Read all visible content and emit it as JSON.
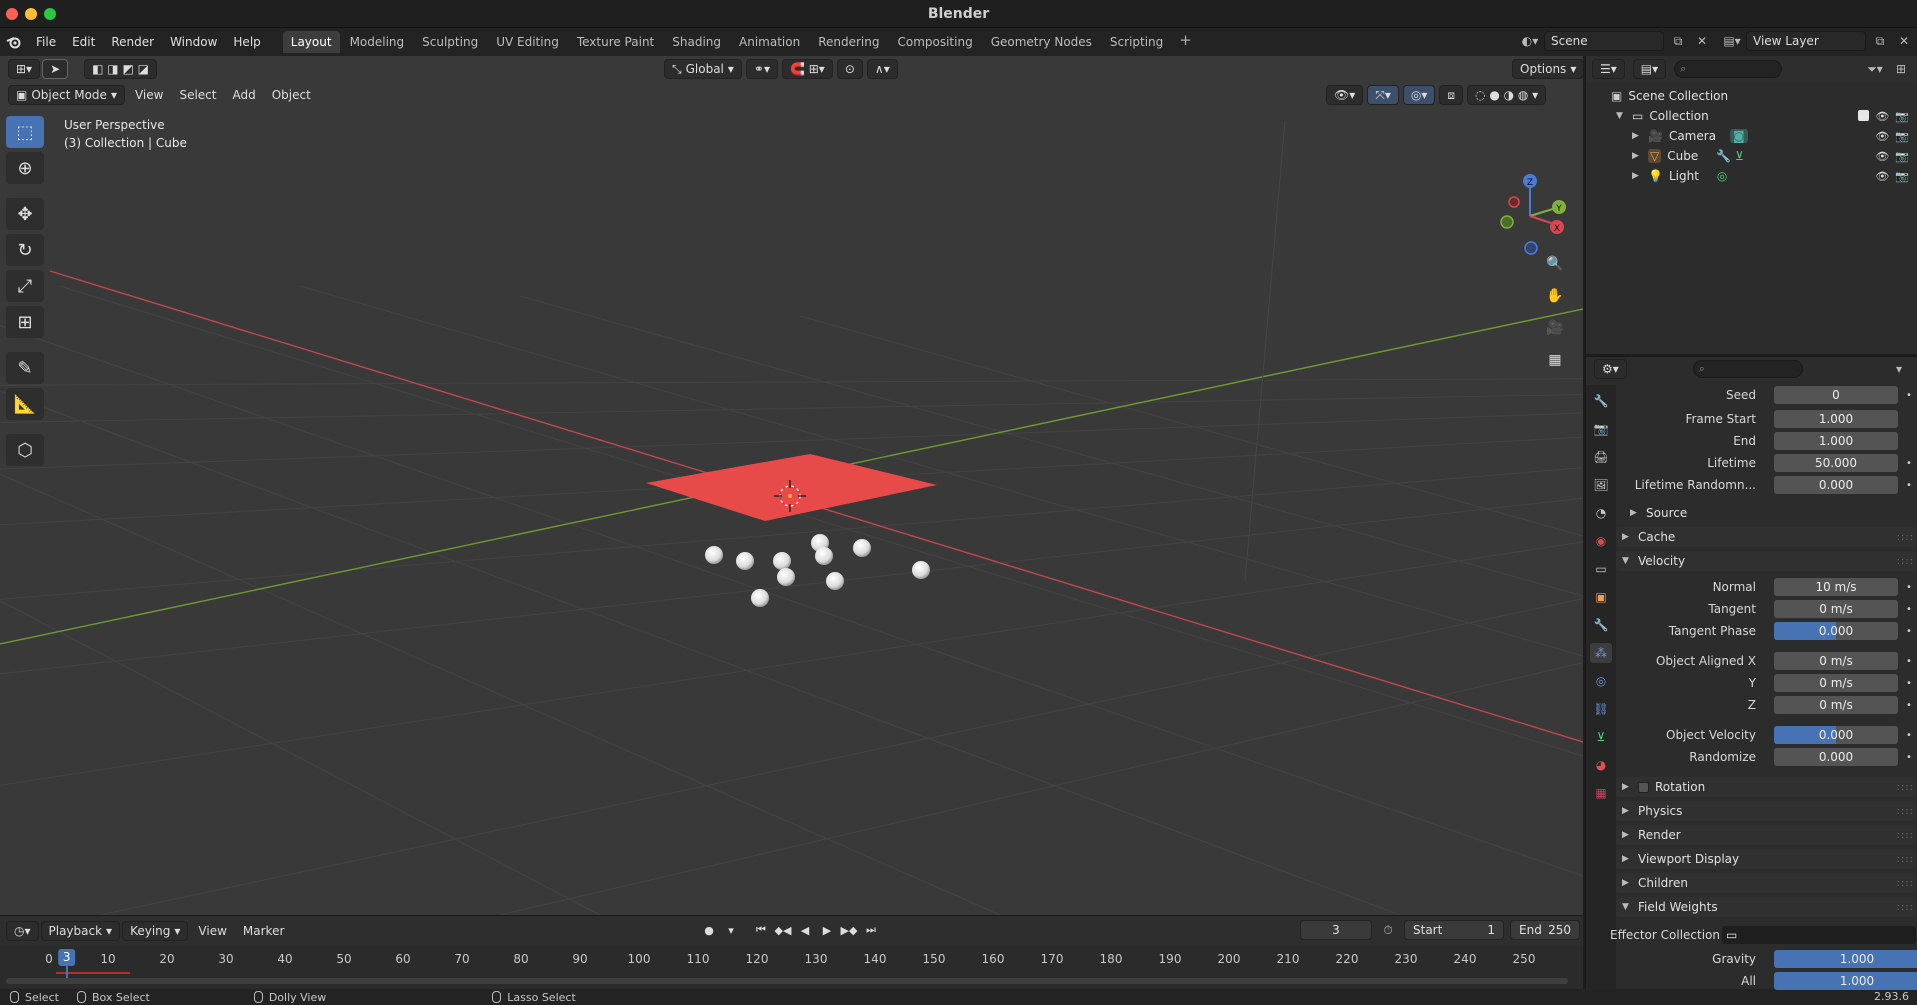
{
  "window": {
    "title": "Blender"
  },
  "menu": [
    "File",
    "Edit",
    "Render",
    "Window",
    "Help"
  ],
  "workspaces": [
    "Layout",
    "Modeling",
    "Sculpting",
    "UV Editing",
    "Texture Paint",
    "Shading",
    "Animation",
    "Rendering",
    "Compositing",
    "Geometry Nodes",
    "Scripting"
  ],
  "scene": {
    "name": "Scene",
    "view_layer": "View Layer"
  },
  "viewport": {
    "mode": "Object Mode",
    "menus": [
      "View",
      "Select",
      "Add",
      "Object"
    ],
    "transform_orientation": "Global",
    "options_label": "Options",
    "overlay_line1": "User Perspective",
    "overlay_line2": "(3) Collection | Cube",
    "gizmo": {
      "z": "Z",
      "y": "Y",
      "x": "X"
    }
  },
  "timeline": {
    "menus": [
      "Playback",
      "Keying",
      "View",
      "Marker"
    ],
    "current_frame": "3",
    "start_label": "Start",
    "start": "1",
    "end_label": "End",
    "end": "250",
    "playhead_label": "3",
    "ticks": [
      "0",
      "10",
      "20",
      "30",
      "40",
      "50",
      "60",
      "70",
      "80",
      "90",
      "100",
      "110",
      "120",
      "130",
      "140",
      "150",
      "160",
      "170",
      "180",
      "190",
      "200",
      "210",
      "220",
      "230",
      "240",
      "250"
    ]
  },
  "status": {
    "select": "Select",
    "box_select": "Box Select",
    "dolly": "Dolly View",
    "lasso": "Lasso Select",
    "version": "2.93.6"
  },
  "outliner": {
    "scene_collection": "Scene Collection",
    "collection": "Collection",
    "items": [
      "Camera",
      "Cube",
      "Light"
    ]
  },
  "properties": {
    "emission": [
      {
        "label": "Seed",
        "value": "0"
      },
      {
        "label": "Frame Start",
        "value": "1.000"
      },
      {
        "label": "End",
        "value": "1.000"
      },
      {
        "label": "Lifetime",
        "value": "50.000"
      },
      {
        "label": "Lifetime Randomn...",
        "value": "0.000"
      }
    ],
    "source_label": "Source",
    "cache_label": "Cache",
    "velocity_label": "Velocity",
    "velocity": [
      {
        "label": "Normal",
        "value": "10 m/s"
      },
      {
        "label": "Tangent",
        "value": "0 m/s"
      },
      {
        "label": "Tangent Phase",
        "value": "0.000"
      }
    ],
    "aligned": [
      {
        "label": "Object Aligned X",
        "value": "0 m/s"
      },
      {
        "label": "Y",
        "value": "0 m/s"
      },
      {
        "label": "Z",
        "value": "0 m/s"
      }
    ],
    "object_velocity": [
      {
        "label": "Object Velocity",
        "value": "0.000"
      },
      {
        "label": "Randomize",
        "value": "0.000"
      }
    ],
    "sections": [
      "Rotation",
      "Physics",
      "Render",
      "Viewport Display",
      "Children"
    ],
    "field_weights_label": "Field Weights",
    "effector_collection_label": "Effector Collection",
    "gravity": {
      "label": "Gravity",
      "value": "1.000"
    },
    "all": {
      "label": "All",
      "value": "1.000"
    }
  },
  "colors": {
    "accent": "#4772b3",
    "emitter_plane": "#e84a4a",
    "x_axis": "#c0484a",
    "y_axis": "#6f9a2f"
  }
}
